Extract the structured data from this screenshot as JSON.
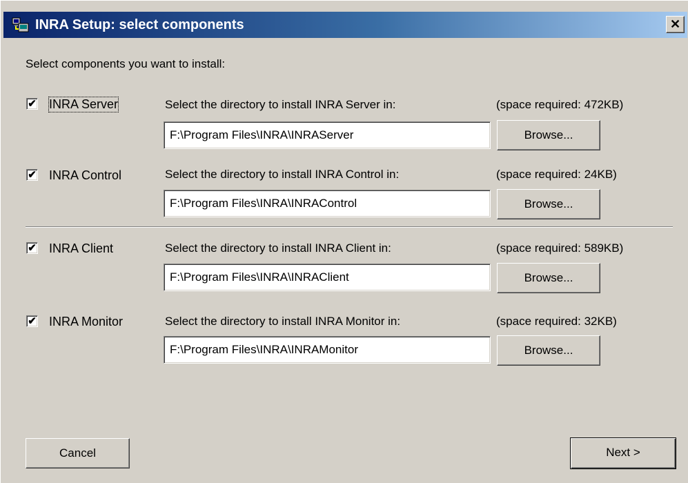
{
  "window": {
    "title": "INRA Setup: select components",
    "close_glyph": "✕"
  },
  "instruction": "Select components you want to install:",
  "check_mark": "✔",
  "components": [
    {
      "name": "INRA Server",
      "checked": true,
      "dir_label": "Select the directory to install INRA Server in:",
      "space": "(space required: 472KB)",
      "path": "F:\\Program Files\\INRA\\INRAServer",
      "browse": "Browse..."
    },
    {
      "name": "INRA Control",
      "checked": true,
      "dir_label": "Select the directory to install INRA Control in:",
      "space": "(space required: 24KB)",
      "path": "F:\\Program Files\\INRA\\INRAControl",
      "browse": "Browse..."
    },
    {
      "name": "INRA Client",
      "checked": true,
      "dir_label": "Select the directory to install INRA Client in:",
      "space": "(space required: 589KB)",
      "path": "F:\\Program Files\\INRA\\INRAClient",
      "browse": "Browse..."
    },
    {
      "name": "INRA Monitor",
      "checked": true,
      "dir_label": "Select the directory to install INRA Monitor in:",
      "space": "(space required: 32KB)",
      "path": "F:\\Program Files\\INRA\\INRAMonitor",
      "browse": "Browse..."
    }
  ],
  "buttons": {
    "cancel": "Cancel",
    "next": "Next >"
  },
  "colors": {
    "titlebar_start": "#0a246a",
    "titlebar_end": "#a6caf0",
    "dialog_bg": "#d4d0c8"
  }
}
